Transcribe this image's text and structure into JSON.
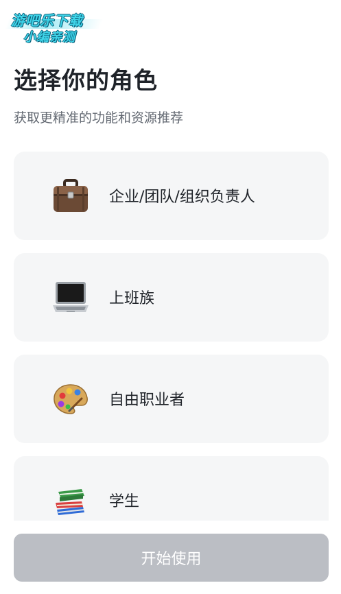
{
  "watermark": {
    "line1": "游吧乐下载",
    "line2": "小编亲测"
  },
  "header": {
    "title": "选择你的角色",
    "subtitle": "获取更精准的功能和资源推荐"
  },
  "roles": [
    {
      "label": "企业/团队/组织负责人",
      "icon": "briefcase-icon"
    },
    {
      "label": "上班族",
      "icon": "laptop-icon"
    },
    {
      "label": "自由职业者",
      "icon": "palette-icon"
    },
    {
      "label": "学生",
      "icon": "books-icon"
    }
  ],
  "footer": {
    "start_label": "开始使用",
    "start_disabled": true
  },
  "colors": {
    "card_background": "#f5f6f7",
    "button_disabled": "#bbbec4",
    "title_text": "#1f2329",
    "subtitle_text": "#646a73"
  }
}
